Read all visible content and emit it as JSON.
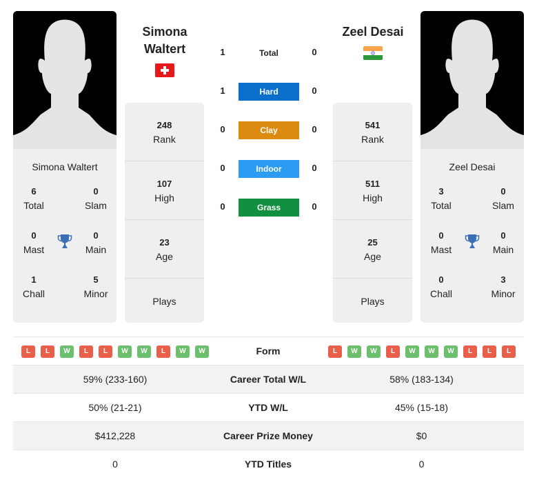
{
  "colors": {
    "hard": "#0a6ecb",
    "clay": "#db8c10",
    "indoor": "#2b9cf2",
    "grass": "#109040",
    "loss": "#e8604c",
    "win": "#6cbf6c",
    "trophy": "#3a6fb8"
  },
  "player1": {
    "name_line1": "Simona",
    "name_line2": "Waltert",
    "card_name": "Simona Waltert",
    "flag": "switzerland-flag",
    "titles": {
      "total": "6",
      "total_label": "Total",
      "slam": "0",
      "slam_label": "Slam",
      "mast": "0",
      "mast_label": "Mast",
      "main": "0",
      "main_label": "Main",
      "chall": "1",
      "chall_label": "Chall",
      "minor": "5",
      "minor_label": "Minor"
    },
    "rank": "248",
    "rank_label": "Rank",
    "high": "107",
    "high_label": "High",
    "age": "23",
    "age_label": "Age",
    "plays_label": "Plays",
    "form": [
      "L",
      "L",
      "W",
      "L",
      "L",
      "W",
      "W",
      "L",
      "W",
      "W"
    ]
  },
  "player2": {
    "name": "Zeel Desai",
    "card_name": "Zeel Desai",
    "flag": "india-flag",
    "titles": {
      "total": "3",
      "total_label": "Total",
      "slam": "0",
      "slam_label": "Slam",
      "mast": "0",
      "mast_label": "Mast",
      "main": "0",
      "main_label": "Main",
      "chall": "0",
      "chall_label": "Chall",
      "minor": "3",
      "minor_label": "Minor"
    },
    "rank": "541",
    "rank_label": "Rank",
    "high": "511",
    "high_label": "High",
    "age": "25",
    "age_label": "Age",
    "plays_label": "Plays",
    "form": [
      "L",
      "W",
      "W",
      "L",
      "W",
      "W",
      "W",
      "L",
      "L",
      "L"
    ]
  },
  "h2h": [
    {
      "label": "Total",
      "left": "1",
      "right": "0",
      "style": "plain"
    },
    {
      "label": "Hard",
      "left": "1",
      "right": "0",
      "style": "hard"
    },
    {
      "label": "Clay",
      "left": "0",
      "right": "0",
      "style": "clay"
    },
    {
      "label": "Indoor",
      "left": "0",
      "right": "0",
      "style": "indoor"
    },
    {
      "label": "Grass",
      "left": "0",
      "right": "0",
      "style": "grass"
    }
  ],
  "stats": {
    "form_label": "Form",
    "rows": [
      {
        "label": "Career Total W/L",
        "left": "59% (233-160)",
        "right": "58% (183-134)"
      },
      {
        "label": "YTD W/L",
        "left": "50% (21-21)",
        "right": "45% (15-18)"
      },
      {
        "label": "Career Prize Money",
        "left": "$412,228",
        "right": "$0"
      },
      {
        "label": "YTD Titles",
        "left": "0",
        "right": "0"
      }
    ]
  }
}
